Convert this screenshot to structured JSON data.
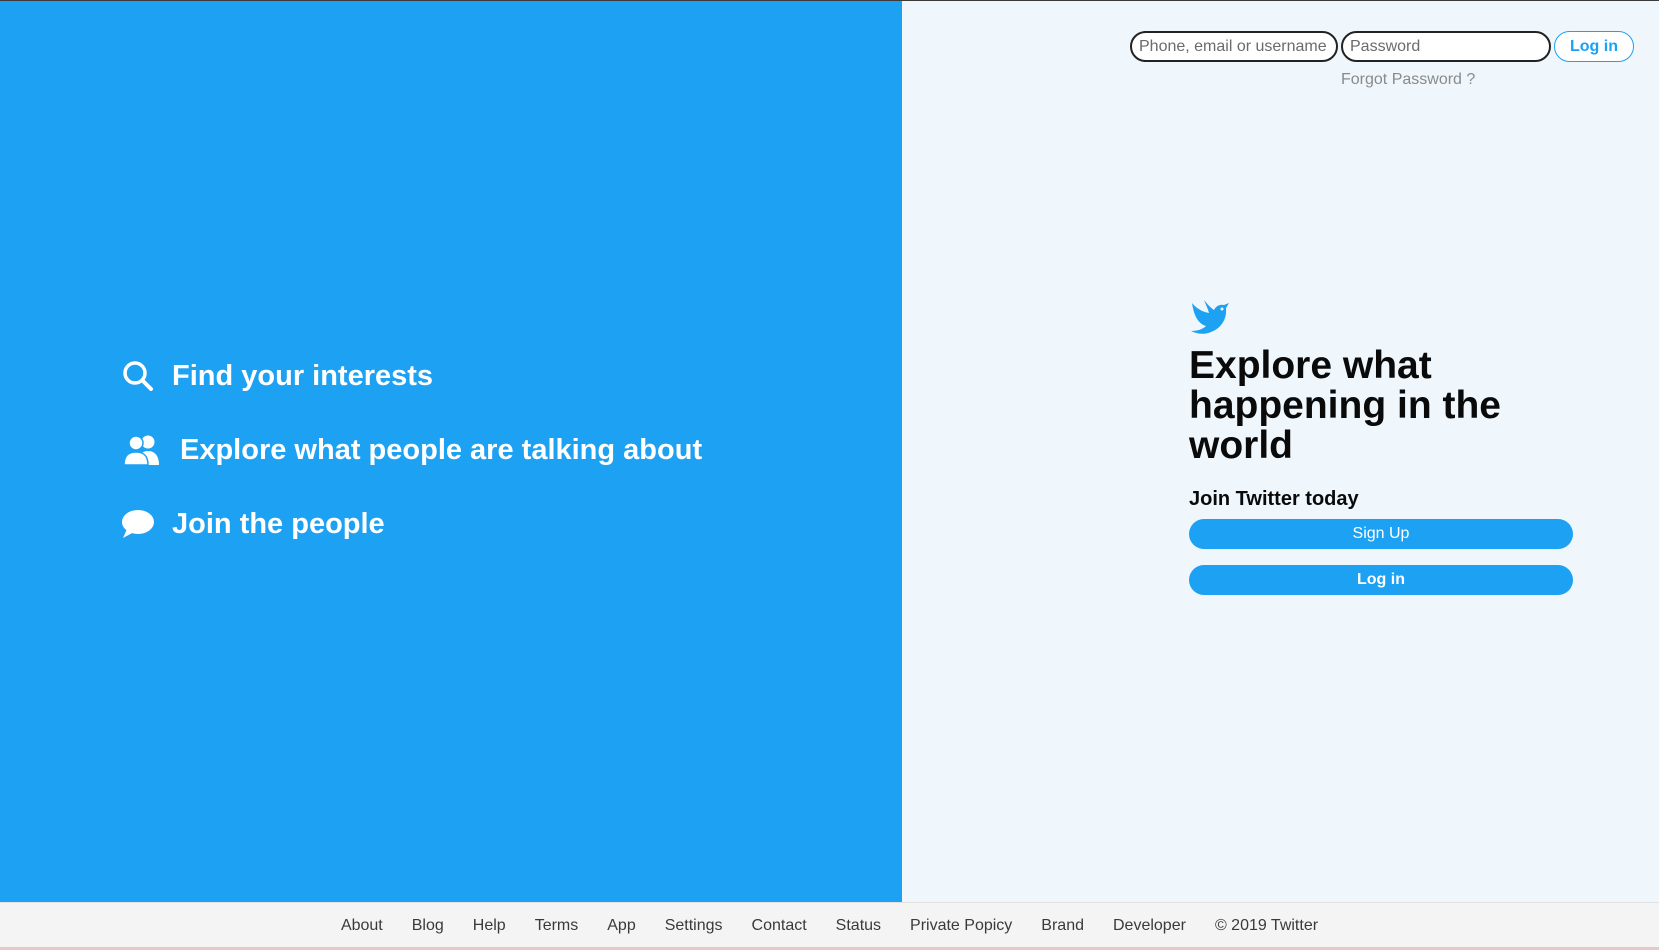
{
  "features": [
    {
      "icon": "search-icon",
      "label": "Find your interests"
    },
    {
      "icon": "people-icon",
      "label": "Explore what people are talking about"
    },
    {
      "icon": "chat-bubble-icon",
      "label": "Join the people"
    }
  ],
  "login": {
    "username_placeholder": "Phone, email or username",
    "password_placeholder": "Password",
    "button_label": "Log in",
    "forgot_label": "Forgot Password ?"
  },
  "hero": {
    "title": "Explore what happening in the world",
    "subtitle": "Join Twitter today",
    "signup_label": "Sign Up",
    "login_label": "Log in"
  },
  "footer": {
    "links": [
      "About",
      "Blog",
      "Help",
      "Terms",
      "App",
      "Settings",
      "Contact",
      "Status",
      "Private Popicy",
      "Brand",
      "Developer"
    ],
    "copyright": "© 2019 Twitter"
  },
  "colors": {
    "brand_blue": "#1da1f2",
    "right_bg": "#f0f7fc",
    "footer_bg": "#f4f4f4"
  }
}
